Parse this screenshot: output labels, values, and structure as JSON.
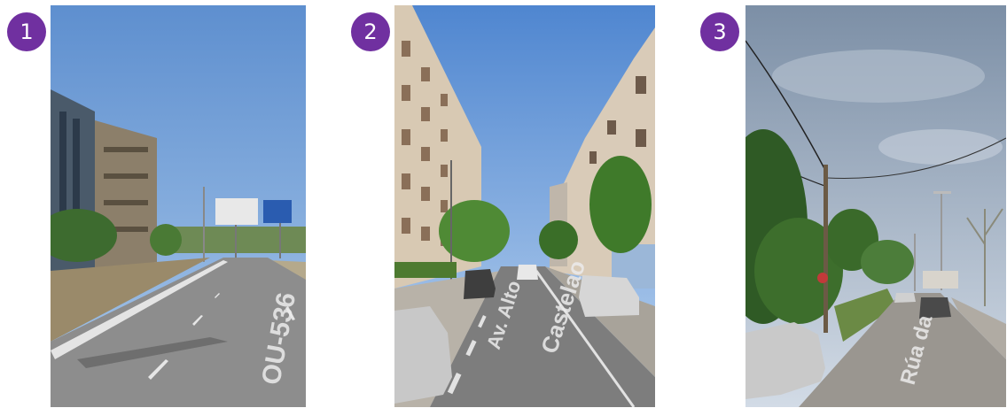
{
  "panels": [
    {
      "number": "1",
      "road_text": "OU-536",
      "description_icon": "street-view-photo"
    },
    {
      "number": "2",
      "road_text_1": "Av. Alto",
      "road_text_2": "Castelao",
      "description_icon": "street-view-photo"
    },
    {
      "number": "3",
      "road_text": "Rúa da",
      "description_icon": "street-view-photo"
    }
  ],
  "colors": {
    "badge": "#7030a0",
    "sky": "#6f9fd6",
    "road": "#8a8a8a"
  }
}
